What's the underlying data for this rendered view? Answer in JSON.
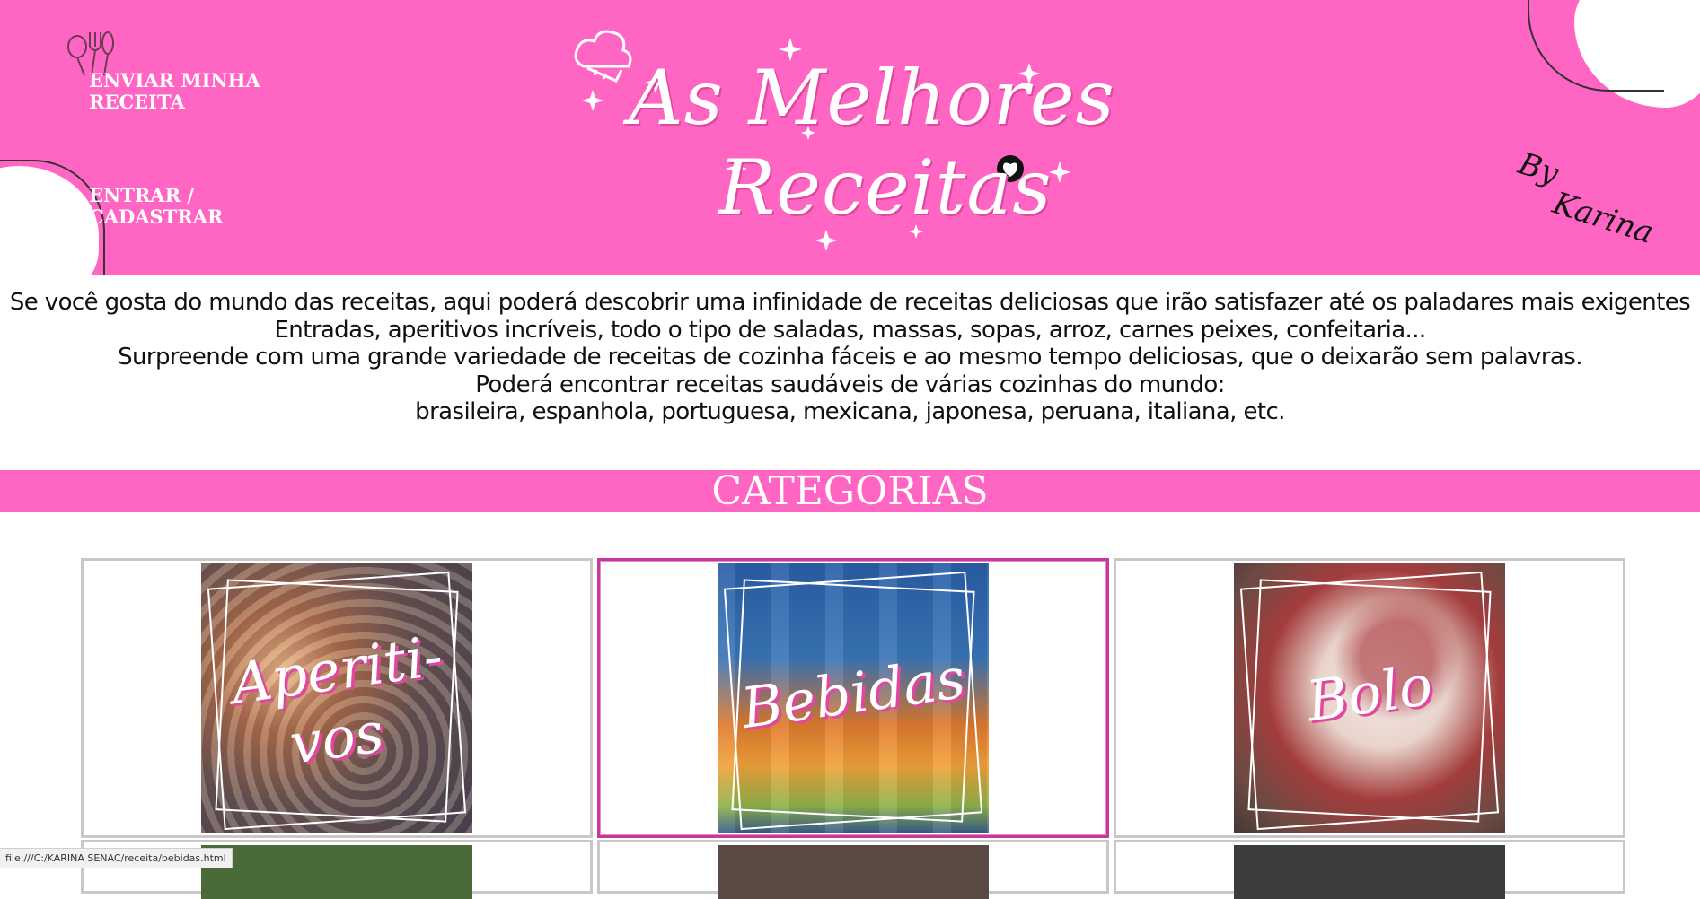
{
  "header": {
    "nav": {
      "send_recipe": "ENVIAR MINHA RECEITA",
      "login": "ENTRAR / CADASTRAR"
    },
    "logo": {
      "line1": "As Melhores",
      "line2": "Receitas"
    },
    "byline": {
      "by": "By",
      "name": "Karina"
    },
    "colors": {
      "brand_pink": "#ff66c4",
      "accent_pink": "#e0479e"
    }
  },
  "intro": {
    "lines": [
      "Se você gosta do mundo das receitas, aqui poderá descobrir uma infinidade de receitas deliciosas que irão satisfazer até os paladares mais exigentes",
      "Entradas, aperitivos incríveis, todo o tipo de saladas, massas, sopas, arroz, carnes peixes, confeitaria...",
      "Surpreende com uma grande variedade de receitas de cozinha fáceis e ao mesmo tempo deliciosas, que o deixarão sem palavras.",
      "Poderá encontrar receitas saudáveis de várias cozinhas do mundo:",
      "brasileira, espanhola, portuguesa, mexicana, japonesa, peruana, italiana, etc."
    ]
  },
  "categories": {
    "title": "CATEGORIAS",
    "items": [
      {
        "label_part1": "Aperiti-",
        "label_part2": "vos"
      },
      {
        "label": "Bebidas"
      },
      {
        "label": "Bolo"
      }
    ]
  },
  "statusbar": {
    "url": "file:///C:/KARINA SENAC/receita/bebidas.html"
  }
}
